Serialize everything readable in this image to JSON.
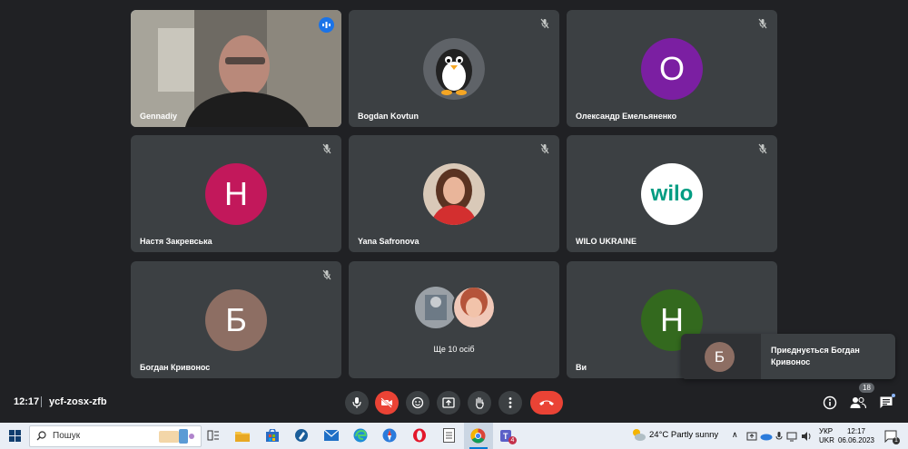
{
  "participants": [
    {
      "name": "Gennadiy",
      "type": "video"
    },
    {
      "name": "Bogdan Kovtun",
      "type": "image"
    },
    {
      "name": "Олександр Емельяненко",
      "type": "letter",
      "letter": "О",
      "color": "#7b1fa2"
    },
    {
      "name": "Настя Закревська",
      "type": "letter",
      "letter": "Н",
      "color": "#c2185b"
    },
    {
      "name": "Yana Safronova",
      "type": "photo"
    },
    {
      "name": "WILO UKRAINE",
      "type": "logo",
      "logo_text": "wilo",
      "color": "#009c82"
    },
    {
      "name": "Богдан Кривонос",
      "type": "letter",
      "letter": "Б",
      "color": "#8d6e63"
    },
    {
      "name": "Ще 10 осіб",
      "type": "others"
    },
    {
      "name": "Ви",
      "type": "letter",
      "letter": "Н",
      "color": "#33691e"
    }
  ],
  "meeting": {
    "time": "12:17",
    "code": "ycf-zosx-zfb"
  },
  "people_count": "18",
  "notification": {
    "letter": "Б",
    "text": "Приєднується Богдан Кривонос",
    "color": "#8d6e63"
  },
  "controls": [
    "mic-icon",
    "camera-off-icon",
    "emoji-icon",
    "present-icon",
    "raise-hand-icon",
    "more-options-icon",
    "end-call-icon"
  ],
  "right_icons": [
    "info-icon",
    "people-icon",
    "chat-icon"
  ],
  "taskbar": {
    "search_placeholder": "Пошук",
    "weather": "24°C  Partly sunny",
    "lang_top": "УКР",
    "lang_bottom": "UKR",
    "clock_time": "12:17",
    "clock_date": "06.06.2023",
    "teams_badge": "4",
    "notif_count": "1"
  }
}
